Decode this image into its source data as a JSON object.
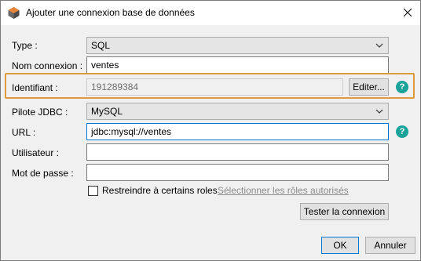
{
  "window": {
    "title": "Ajouter une connexion base de données"
  },
  "form": {
    "type": {
      "label": "Type :",
      "value": "SQL"
    },
    "nom_connexion": {
      "label": "Nom connexion :",
      "value": "ventes"
    },
    "identifiant": {
      "label": "Identifiant :",
      "value": "191289384",
      "edit_label": "Editer..."
    },
    "pilote_jdbc": {
      "label": "Pilote JDBC :",
      "value": "MySQL"
    },
    "url": {
      "label": "URL :",
      "value": "jdbc:mysql://ventes"
    },
    "utilisateur": {
      "label": "Utilisateur :",
      "value": ""
    },
    "mot_de_passe": {
      "label": "Mot de passe :",
      "value": ""
    },
    "restrict_roles": {
      "label": "Restreindre à certains roles",
      "checked": false
    },
    "select_roles_link": "Sélectionner les rôles autorisés",
    "test_button": "Tester la connexion"
  },
  "footer": {
    "ok_label": "OK",
    "cancel_label": "Annuler"
  },
  "icons": {
    "help_glyph": "?"
  },
  "colors": {
    "highlight": "#e09a3e",
    "help": "#1aa39a",
    "focus": "#0078d7"
  }
}
